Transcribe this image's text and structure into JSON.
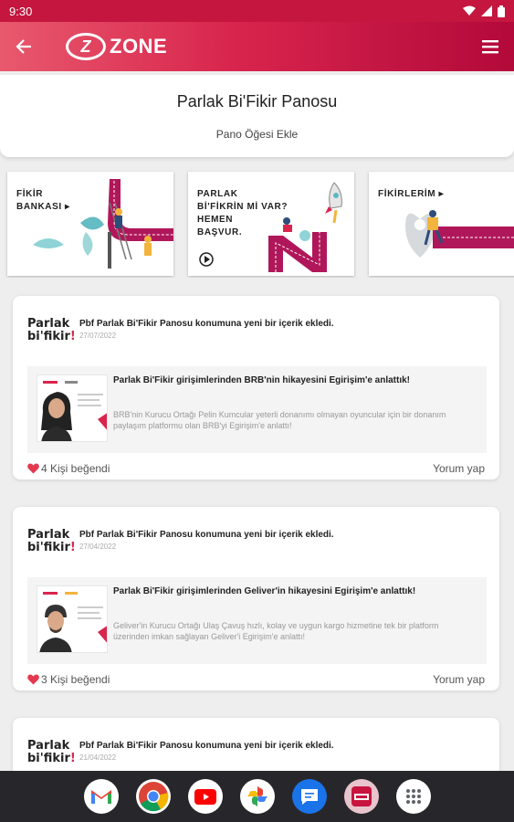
{
  "status": {
    "time": "9:30"
  },
  "appbar": {
    "logo_letter": "Z",
    "logo_text": "ZONE"
  },
  "page": {
    "title": "Parlak Bi'Fikir Panosu",
    "add_item": "Pano Öğesi Ekle"
  },
  "banners": [
    {
      "line1": "FİKİR",
      "line2": "BANKASI ▸"
    },
    {
      "line1": "PARLAK",
      "line2": "Bİ'FİKRİN Mİ VAR?",
      "line3": "HEMEN",
      "line4": "BAŞVUR."
    },
    {
      "line1": "FİKİRLERİM ▸"
    }
  ],
  "posts": [
    {
      "logo_line1": "Parlak",
      "logo_line2": "bi'fikir",
      "logo_dot": "!",
      "header": "Pbf Parlak Bi'Fikir Panosu konumuna yeni bir içerik ekledi.",
      "date": "27/07/2022",
      "share_title": "Parlak Bi'Fikir girişimlerinden BRB'nin hikayesini Egirişim'e anlattık!",
      "share_desc": "BRB'nin Kurucu Ortağı Pelin Kumcular yeterli donanımı olmayan oyuncular için bir donanım paylaşım platformu olan BRB'yi Egirişim'e anlattı!",
      "likes": "4 Kişi beğendi",
      "comment": "Yorum yap"
    },
    {
      "logo_line1": "Parlak",
      "logo_line2": "bi'fikir",
      "logo_dot": "!",
      "header": "Pbf Parlak Bi'Fikir Panosu konumuna yeni bir içerik ekledi.",
      "date": "27/04/2022",
      "share_title": "Parlak Bi'Fikir girişimlerinden Geliver'in hikayesini Egirişim'e anlattık!",
      "share_desc": "Geliver'in Kurucu Ortağı Ulaş Çavuş hızlı, kolay ve uygun kargo hizmetine tek bir platform üzerinden imkan sağlayan Geliver'i Egirişim'e anlattı!",
      "likes": "3 Kişi beğendi",
      "comment": "Yorum yap"
    },
    {
      "logo_line1": "Parlak",
      "logo_line2": "bi'fikir",
      "logo_dot": "!",
      "header": "Pbf Parlak Bi'Fikir Panosu konumuna yeni bir içerik ekledi.",
      "date": "21/04/2022"
    }
  ],
  "dock": [
    "gmail-icon",
    "chrome-icon",
    "youtube-icon",
    "photos-icon",
    "messages-icon",
    "zone-app-icon",
    "app-drawer-icon"
  ],
  "colors": {
    "brand": "#d8254d",
    "brand_dark": "#b3093a",
    "like": "#e53950"
  }
}
